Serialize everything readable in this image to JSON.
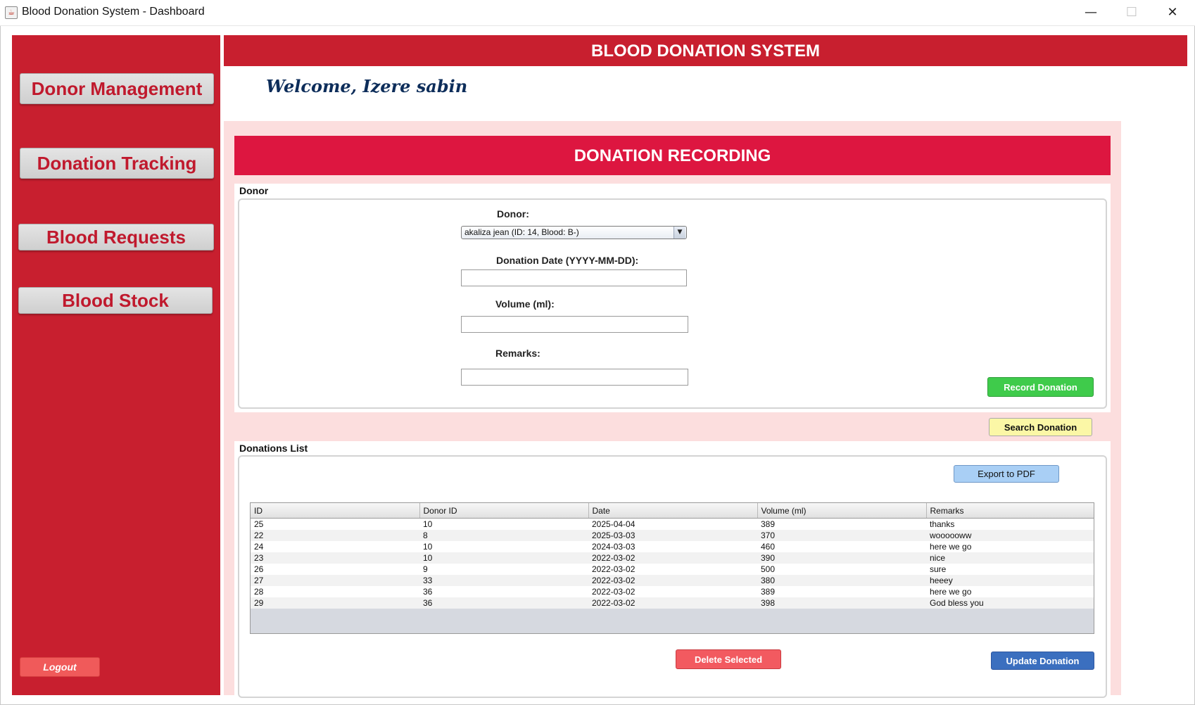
{
  "window": {
    "title": "Blood Donation System - Dashboard",
    "controls": {
      "minimize": "—",
      "maximize": "☐",
      "close": "✕"
    }
  },
  "sidebar": {
    "items": [
      {
        "label": "Donor Management"
      },
      {
        "label": "Donation Tracking"
      },
      {
        "label": "Blood Requests"
      },
      {
        "label": "Blood Stock"
      }
    ],
    "logout_label": "Logout"
  },
  "header": {
    "title": "BLOOD DONATION SYSTEM",
    "welcome": "Welcome, Izere sabin"
  },
  "section": {
    "title": "DONATION RECORDING"
  },
  "donor_form": {
    "legend": "Donor",
    "donor_label": "Donor:",
    "donor_selected": "akaliza jean (ID: 14, Blood: B-)",
    "date_label": "Donation Date (YYYY-MM-DD):",
    "date_value": "",
    "volume_label": "Volume (ml):",
    "volume_value": "",
    "remarks_label": "Remarks:",
    "remarks_value": "",
    "record_button": "Record Donation",
    "search_button": "Search Donation"
  },
  "donations_list": {
    "legend": "Donations List",
    "export_button": "Export to PDF",
    "columns": [
      "ID",
      "Donor ID",
      "Date",
      "Volume (ml)",
      "Remarks"
    ],
    "rows": [
      [
        "25",
        "10",
        "2025-04-04",
        "389",
        "thanks"
      ],
      [
        "22",
        "8",
        "2025-03-03",
        "370",
        "woooooww"
      ],
      [
        "24",
        "10",
        "2024-03-03",
        "460",
        "here we go"
      ],
      [
        "23",
        "10",
        "2022-03-02",
        "390",
        "nice"
      ],
      [
        "26",
        "9",
        "2022-03-02",
        "500",
        "sure"
      ],
      [
        "27",
        "33",
        "2022-03-02",
        "380",
        "heeey"
      ],
      [
        "28",
        "36",
        "2022-03-02",
        "389",
        "here we go"
      ],
      [
        "29",
        "36",
        "2022-03-02",
        "398",
        "God bless you"
      ]
    ],
    "delete_button": "Delete Selected",
    "update_button": "Update Donation"
  },
  "icons": {
    "app": "java-coffee-icon",
    "dropdown": "dropdown-arrow-icon"
  },
  "colors": {
    "brand_red": "#c81f2f",
    "banner_red": "#dd1640",
    "panel_pink": "#fcdede",
    "record_green": "#3fcb4b",
    "search_yellow": "#fbf7a6",
    "export_blue": "#a9cff5",
    "delete_red": "#f25a60",
    "update_blue": "#3b6fbf",
    "welcome_navy": "#0d2d5a"
  }
}
